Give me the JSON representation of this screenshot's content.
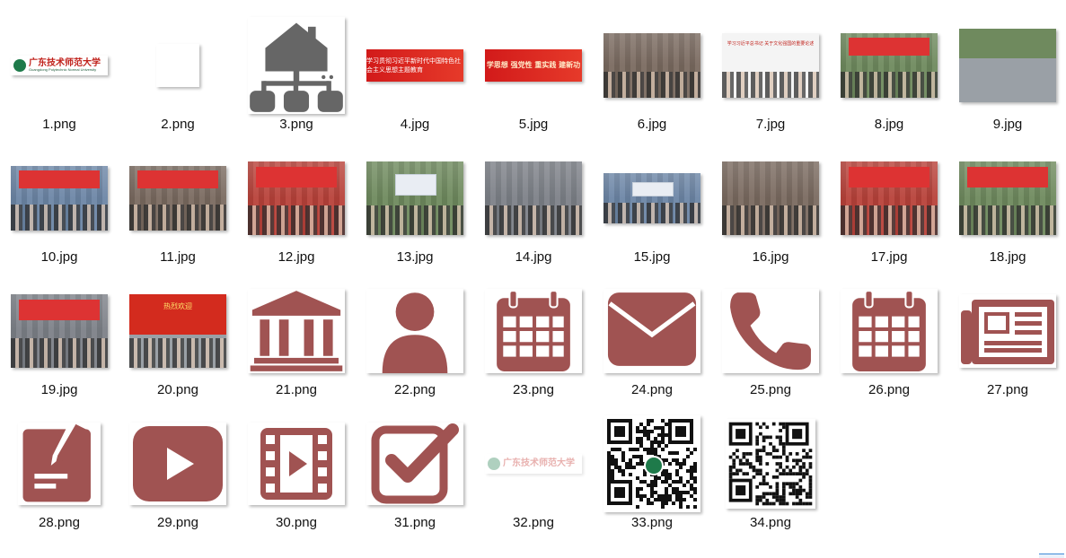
{
  "window": {
    "title": ""
  },
  "colors": {
    "icon_brand": "#a05352",
    "background": "#ffffff",
    "label": "#111111"
  },
  "files": [
    {
      "name": "1.png",
      "kind": "logo",
      "text": "广东技术师范大学",
      "subtext": "Guangdong Polytechnic Normal University"
    },
    {
      "name": "2.png",
      "kind": "blank"
    },
    {
      "name": "3.png",
      "kind": "icon",
      "icon": "house-network-icon"
    },
    {
      "name": "4.jpg",
      "kind": "banner",
      "text": "学习贯彻习近平新时代中国特色社会主义思想主题教育"
    },
    {
      "name": "5.jpg",
      "kind": "banner",
      "text": "学思想 强党性 重实践 建新功"
    },
    {
      "name": "6.jpg",
      "kind": "photo",
      "icon": "group-photo"
    },
    {
      "name": "7.jpg",
      "kind": "photo",
      "icon": "speaker-photo",
      "text": "学习习近平总书记 关于文化强国的重要论述"
    },
    {
      "name": "8.jpg",
      "kind": "photo",
      "icon": "auditorium-photo"
    },
    {
      "name": "9.jpg",
      "kind": "photo",
      "icon": "road-photo"
    },
    {
      "name": "10.jpg",
      "kind": "photo",
      "icon": "meeting-photo"
    },
    {
      "name": "11.jpg",
      "kind": "photo",
      "icon": "meeting-photo"
    },
    {
      "name": "12.jpg",
      "kind": "photo",
      "icon": "meeting-photo"
    },
    {
      "name": "13.jpg",
      "kind": "photo",
      "icon": "classroom-photo"
    },
    {
      "name": "14.jpg",
      "kind": "photo",
      "icon": "group-photo"
    },
    {
      "name": "15.jpg",
      "kind": "photo",
      "icon": "classroom-photo"
    },
    {
      "name": "16.jpg",
      "kind": "photo",
      "icon": "group-photo"
    },
    {
      "name": "17.jpg",
      "kind": "photo",
      "icon": "meeting-photo"
    },
    {
      "name": "18.jpg",
      "kind": "photo",
      "icon": "auditorium-photo"
    },
    {
      "name": "19.jpg",
      "kind": "photo",
      "icon": "meeting-photo"
    },
    {
      "name": "20.png",
      "kind": "photo",
      "icon": "group-photo",
      "text": "热烈欢迎"
    },
    {
      "name": "21.png",
      "kind": "icon",
      "icon": "bank-icon"
    },
    {
      "name": "22.png",
      "kind": "icon",
      "icon": "user-icon"
    },
    {
      "name": "23.png",
      "kind": "icon",
      "icon": "calendar-icon"
    },
    {
      "name": "24.png",
      "kind": "icon",
      "icon": "envelope-icon"
    },
    {
      "name": "25.png",
      "kind": "icon",
      "icon": "phone-icon"
    },
    {
      "name": "26.png",
      "kind": "icon",
      "icon": "calendar-icon"
    },
    {
      "name": "27.png",
      "kind": "icon",
      "icon": "newspaper-icon"
    },
    {
      "name": "28.png",
      "kind": "icon",
      "icon": "edit-document-icon"
    },
    {
      "name": "29.png",
      "kind": "icon",
      "icon": "video-play-icon"
    },
    {
      "name": "30.png",
      "kind": "icon",
      "icon": "film-icon"
    },
    {
      "name": "31.png",
      "kind": "icon",
      "icon": "checkbox-icon"
    },
    {
      "name": "32.png",
      "kind": "logo-faded",
      "text": "广东技术师范大学"
    },
    {
      "name": "33.png",
      "kind": "qrcode",
      "icon": "qrcode-icon"
    },
    {
      "name": "34.png",
      "kind": "qrcode",
      "icon": "qrcode-icon"
    }
  ]
}
